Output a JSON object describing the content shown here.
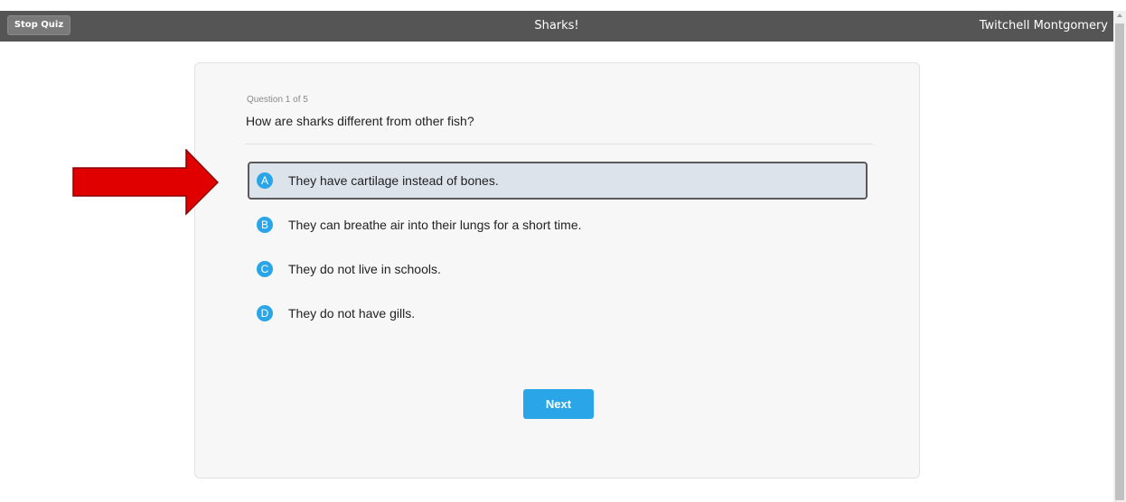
{
  "topbar": {
    "stop_label": "Stop Quiz",
    "title": "Sharks!",
    "user": "Twitchell Montgomery"
  },
  "question": {
    "counter": "Question 1 of 5",
    "text": "How are sharks different from other fish?"
  },
  "options": [
    {
      "letter": "A",
      "text": "They have cartilage instead of bones.",
      "selected": true
    },
    {
      "letter": "B",
      "text": "They can breathe air into their lungs for a short time.",
      "selected": false
    },
    {
      "letter": "C",
      "text": "They do not live in schools.",
      "selected": false
    },
    {
      "letter": "D",
      "text": "They do not have gills.",
      "selected": false
    }
  ],
  "next_label": "Next",
  "colors": {
    "accent": "#2aa6e8",
    "topbar": "#555555",
    "selected_bg": "#dde3ea",
    "arrow": "#e00000"
  },
  "icons": {
    "annotation": "red-arrow-icon"
  }
}
